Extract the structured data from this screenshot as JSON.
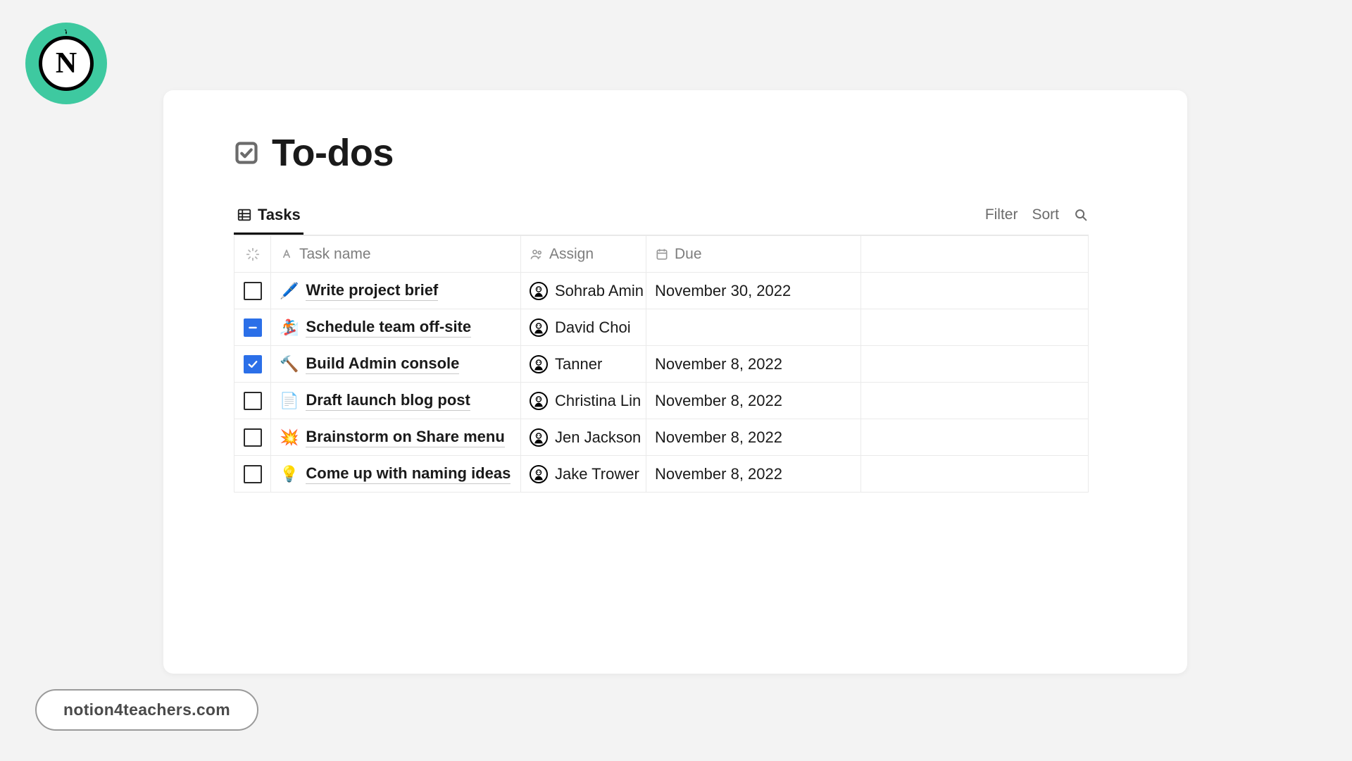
{
  "logo": {
    "letter": "N"
  },
  "page": {
    "title": "To-dos",
    "icon": "checkbox-icon"
  },
  "toolbar": {
    "tab_label": "Tasks",
    "filter_label": "Filter",
    "sort_label": "Sort"
  },
  "columns": {
    "status": "",
    "task": "Task name",
    "assign": "Assign",
    "due": "Due"
  },
  "rows": [
    {
      "state": "unchecked",
      "emoji": "🖊️",
      "task": "Write project brief",
      "assignee": "Sohrab Amin",
      "due": "November 30, 2022"
    },
    {
      "state": "indeterminate",
      "emoji": "🏂",
      "task": "Schedule team off-site",
      "assignee": "David Choi",
      "due": ""
    },
    {
      "state": "checked",
      "emoji": "🔨",
      "task": "Build Admin console",
      "assignee": "Tanner",
      "due": "November 8, 2022"
    },
    {
      "state": "unchecked",
      "emoji": "📄",
      "task": "Draft launch blog post",
      "assignee": "Christina Lin",
      "due": "November 8, 2022"
    },
    {
      "state": "unchecked",
      "emoji": "💥",
      "task": "Brainstorm on Share menu",
      "assignee": "Jen Jackson",
      "due": "November 8, 2022"
    },
    {
      "state": "unchecked",
      "emoji": "💡",
      "task": "Come up with naming ideas",
      "assignee": "Jake Trower",
      "due": "November 8, 2022"
    }
  ],
  "footer": {
    "site": "notion4teachers.com"
  }
}
